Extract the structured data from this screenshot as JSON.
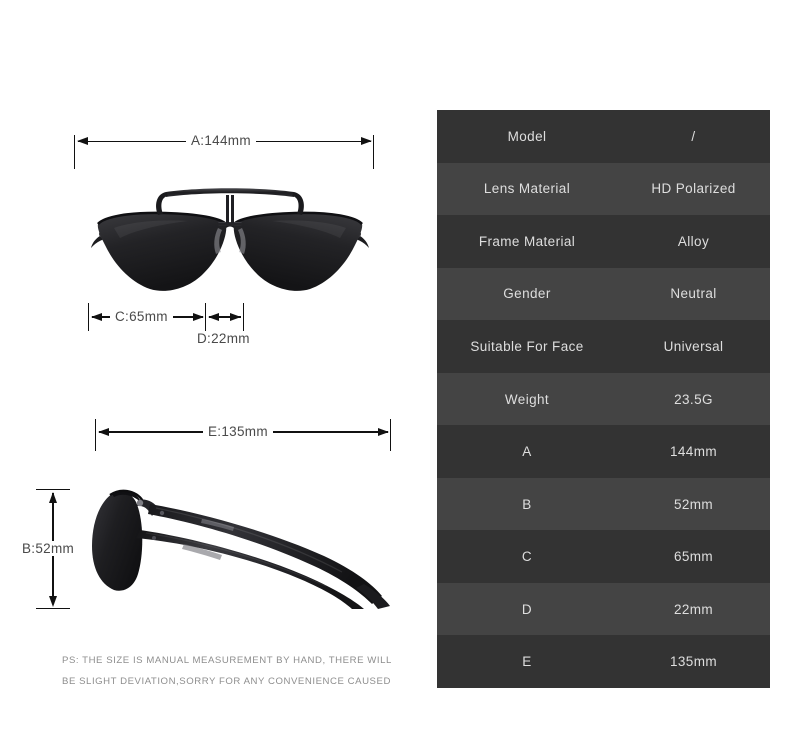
{
  "product": {
    "type": "aviator-sunglasses",
    "front_view_alt": "Front view of black aviator sunglasses with dark polarized lenses and double brow bar",
    "side_view_alt": "Side profile view of black aviator sunglasses showing temple arm"
  },
  "dimensions": {
    "a": {
      "label": "A:144mm",
      "letter": "A",
      "value": "144mm"
    },
    "b": {
      "label": "B:52mm",
      "letter": "B",
      "value": "52mm"
    },
    "c": {
      "label": "C:65mm",
      "letter": "C",
      "value": "65mm"
    },
    "d": {
      "label": "D:22mm",
      "letter": "D",
      "value": "22mm"
    },
    "e": {
      "label": "E:135mm",
      "letter": "E",
      "value": "135mm"
    }
  },
  "note": {
    "line1": "PS: THE SIZE IS MANUAL MEASUREMENT BY HAND, THERE WILL",
    "line2": "BE SLIGHT DEVIATION,SORRY FOR ANY CONVENIENCE CAUSED"
  },
  "spec_table": {
    "rows": [
      {
        "key": "Model",
        "value": "/"
      },
      {
        "key": "Lens Material",
        "value": "HD Polarized"
      },
      {
        "key": "Frame Material",
        "value": "Alloy"
      },
      {
        "key": "Gender",
        "value": "Neutral"
      },
      {
        "key": "Suitable For Face",
        "value": "Universal"
      },
      {
        "key": "Weight",
        "value": "23.5G"
      },
      {
        "key": "A",
        "value": "144mm"
      },
      {
        "key": "B",
        "value": "52mm"
      },
      {
        "key": "C",
        "value": "65mm"
      },
      {
        "key": "D",
        "value": "22mm"
      },
      {
        "key": "E",
        "value": "135mm"
      }
    ]
  },
  "colors": {
    "background": "#ffffff",
    "row_dark": "#333333",
    "row_light": "#444444",
    "table_text": "#dedede",
    "dim_text": "#4a4a4a",
    "note_text": "#8e8e8e",
    "line": "#111111"
  }
}
